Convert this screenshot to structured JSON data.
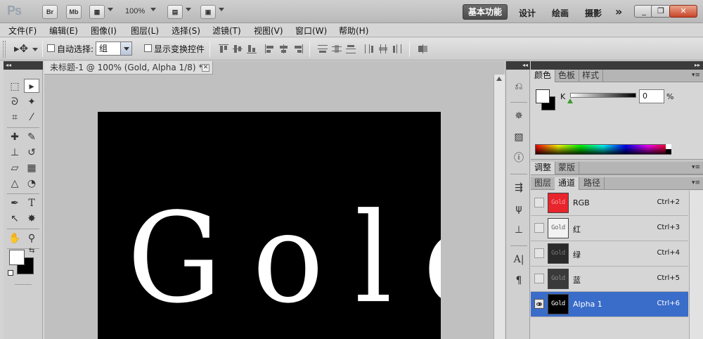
{
  "app": {
    "logo": "Ps",
    "bridge_btn": "Br",
    "minibridge_btn": "Mb",
    "zoom": "100%",
    "workspaces": [
      "基本功能",
      "设计",
      "绘画",
      "摄影"
    ],
    "more": "»"
  },
  "menu": [
    "文件(F)",
    "编辑(E)",
    "图像(I)",
    "图层(L)",
    "选择(S)",
    "滤镜(T)",
    "视图(V)",
    "窗口(W)",
    "帮助(H)"
  ],
  "options": {
    "auto_select_label": "自动选择:",
    "auto_select_value": "组",
    "show_transform_label": "显示变换控件"
  },
  "document": {
    "tab_title": "未标题-1 @ 100% (Gold, Alpha 1/8) *",
    "canvas_text": "Gold"
  },
  "color_panel": {
    "tabs": [
      "颜色",
      "色板",
      "样式"
    ],
    "channel_label": "K",
    "value": "0",
    "unit": "%"
  },
  "adjust_panel": {
    "tabs": [
      "调整",
      "蒙版"
    ]
  },
  "channels_panel": {
    "tabs": [
      "图层",
      "通道",
      "路径"
    ],
    "rows": [
      {
        "name": "RGB",
        "shortcut": "Ctrl+2",
        "thumb": "Gold",
        "thumb_bg": "#e8242c",
        "thumb_fg": "#f5a0a0",
        "visible": false,
        "selected": false
      },
      {
        "name": "红",
        "shortcut": "Ctrl+3",
        "thumb": "Gold",
        "thumb_bg": "#f2f2f2",
        "thumb_fg": "#666666",
        "visible": false,
        "selected": false
      },
      {
        "name": "绿",
        "shortcut": "Ctrl+4",
        "thumb": "Gold",
        "thumb_bg": "#2a2a2a",
        "thumb_fg": "#777777",
        "visible": false,
        "selected": false
      },
      {
        "name": "蓝",
        "shortcut": "Ctrl+5",
        "thumb": "Gold",
        "thumb_bg": "#3a3a3a",
        "thumb_fg": "#888888",
        "visible": false,
        "selected": false
      },
      {
        "name": "Alpha 1",
        "shortcut": "Ctrl+6",
        "thumb": "Gold",
        "thumb_bg": "#000000",
        "thumb_fg": "#ffffff",
        "visible": true,
        "selected": true
      }
    ]
  }
}
